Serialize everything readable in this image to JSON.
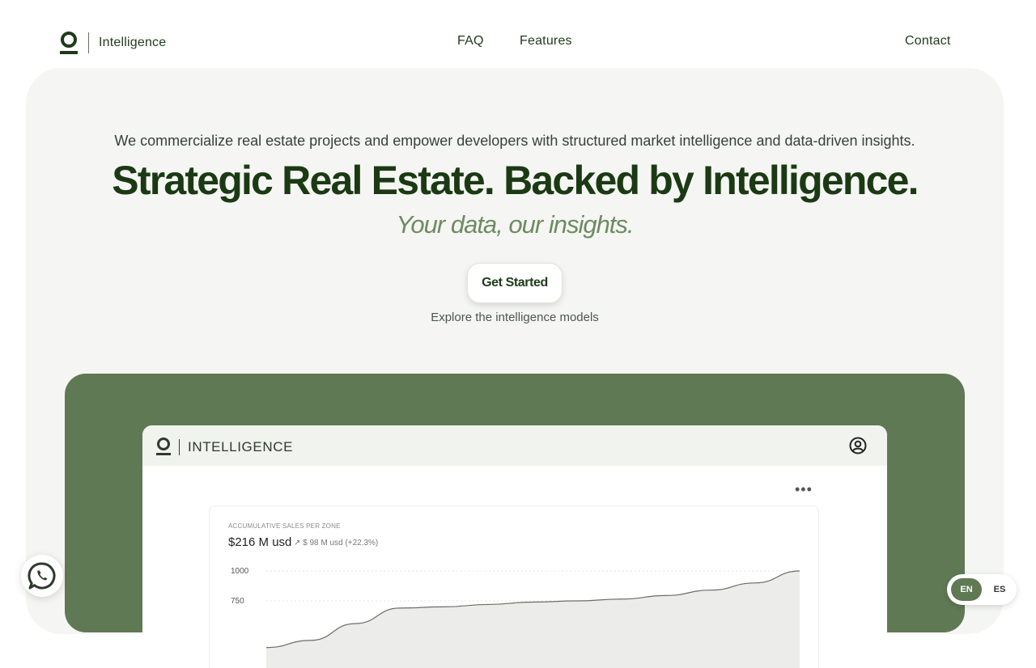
{
  "nav": {
    "brand_name": "Intelligence",
    "links": {
      "faq": "FAQ",
      "features": "Features",
      "contact": "Contact"
    }
  },
  "hero": {
    "subtitle": "We commercialize real estate projects and empower developers with structured market intelligence and data-driven insights.",
    "title": "Strategic Real Estate. Backed by Intelligence.",
    "tagline": "Your data, our insights.",
    "cta_label": "Get Started",
    "explore_text": "Explore the intelligence models"
  },
  "app_preview": {
    "title": "INTELLIGENCE",
    "more_label": "•••",
    "card": {
      "label": "ACCUMULATIVE SALES PER ZONE",
      "value": "$216 M usd",
      "delta": "↗ $ 98 M usd (+22.3%)"
    }
  },
  "chart_data": {
    "type": "area",
    "title": "ACCUMULATIVE SALES PER ZONE",
    "yticks": [
      "1000",
      "750"
    ],
    "ylim": [
      0,
      1000
    ],
    "x": [
      0,
      1,
      2,
      3,
      4,
      5,
      6,
      7,
      8,
      9,
      10,
      11,
      12
    ],
    "series": [
      {
        "values": [
          360,
          420,
          560,
          690,
          700,
          720,
          740,
          750,
          765,
          795,
          840,
          900,
          1000
        ]
      }
    ],
    "grid": true
  },
  "widgets": {
    "lang": {
      "en": "EN",
      "es": "ES"
    }
  },
  "colors": {
    "brand_dark": "#1b3a14",
    "accent_green": "#5f7954",
    "tagline": "#6e8a62",
    "hero_bg": "#f5f6f3"
  }
}
